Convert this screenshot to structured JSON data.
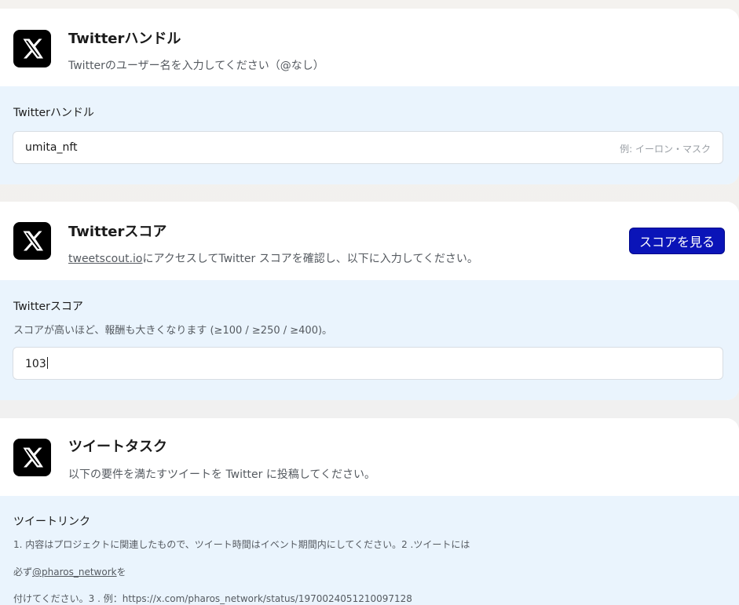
{
  "handle_section": {
    "title": "Twitterハンドル",
    "subtitle": "Twitterのユーザー名を入力してください（@なし）",
    "field_label": "Twitterハンドル",
    "input_value": "umita_nft",
    "placeholder": "例: イーロン・マスク"
  },
  "score_section": {
    "title": "Twitterスコア",
    "subtitle_link": "tweetscout.io",
    "subtitle_rest": "にアクセスしてTwitter スコアを確認し、以下に入力してください。",
    "button_label": "スコアを見る",
    "field_label": "Twitterスコア",
    "field_hint": "スコアが高いほど、報酬も大きくなります (≥100 / ≥250 / ≥400)。",
    "input_value": "103"
  },
  "tweet_section": {
    "title": "ツイートタスク",
    "subtitle": "以下の要件を満たすツイートを Twitter に投稿してください。",
    "field_label": "ツイートリンク",
    "desc_line1": "1. 内容はプロジェクトに関連したもので、ツイート時間はイベント期間内にしてください。2 .ツイートには",
    "desc_line2_prefix": "必ず",
    "desc_line2_link": "@pharos_network",
    "desc_line2_suffix": "を",
    "desc_line3": "付けてください。3 . 例：https://x.com/pharos_network/status/1970024051210097128"
  },
  "icons": {
    "x_logo": "x-logo-icon"
  }
}
